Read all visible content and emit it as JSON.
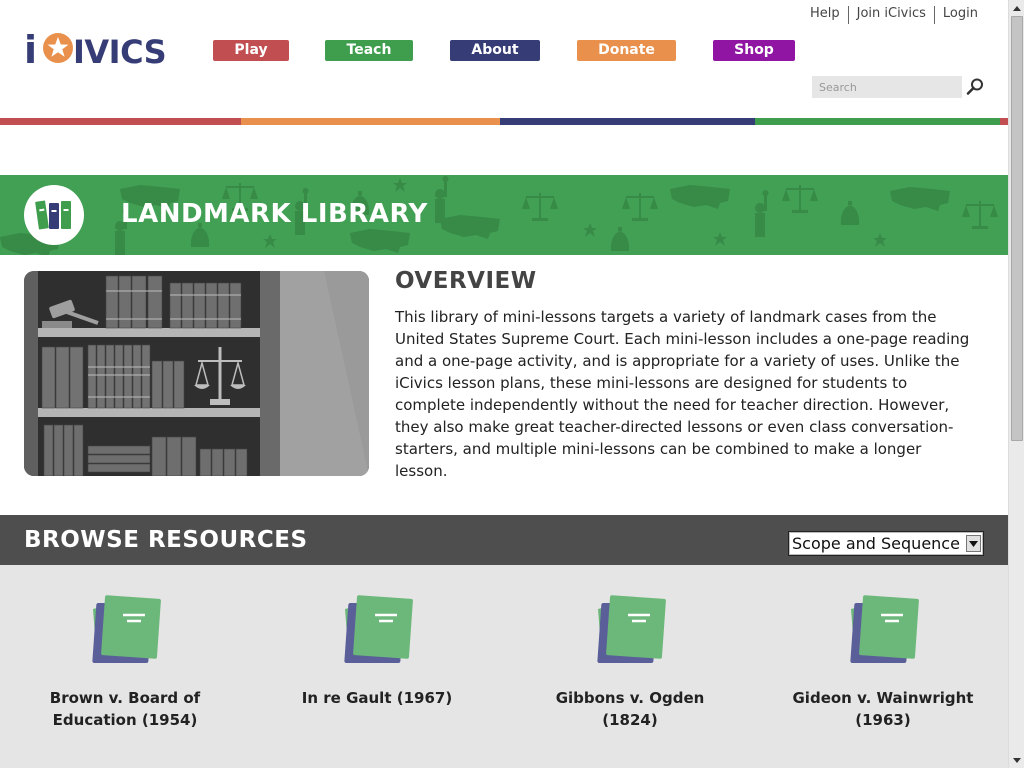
{
  "header": {
    "logo_text": "iCivics",
    "nav": {
      "play": "Play",
      "teach": "Teach",
      "about": "About",
      "donate": "Donate",
      "shop": "Shop"
    },
    "utility_links": {
      "help": "Help",
      "join": "Join iCivics",
      "login": "Login"
    },
    "search": {
      "placeholder": "Search",
      "icon": "search-icon"
    }
  },
  "brand_colors": {
    "red": "#c14f52",
    "orange": "#e9914c",
    "navy": "#363d76",
    "green": "#3e9e4e",
    "purple": "#8f15a2"
  },
  "banner": {
    "title": "LANDMARK LIBRARY",
    "icon": "books-icon"
  },
  "overview": {
    "title": "OVERVIEW",
    "body": "This library of mini-lessons targets a variety of landmark cases from the United States Supreme Court. Each mini-lesson includes a one-page reading and a one-page activity, and is appropriate for a variety of uses. Unlike the iCivics lesson plans, these mini-lessons are designed for students to complete independently without the need for teacher direction. However, they also make great teacher-directed lessons or even class conversation-starters, and multiple mini-lessons can be combined to make a longer lesson."
  },
  "browse": {
    "title": "BROWSE RESOURCES",
    "select_value": "Scope and Sequence",
    "cards": [
      {
        "title": "Brown v. Board of Education (1954)"
      },
      {
        "title": "In re Gault (1967)"
      },
      {
        "title": "Gibbons v. Ogden (1824)"
      },
      {
        "title": "Gideon v. Wainwright (1963)"
      }
    ]
  }
}
